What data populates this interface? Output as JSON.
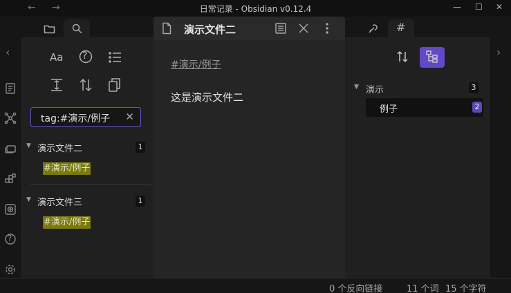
{
  "window": {
    "title": "日常记录 - Obsidian v0.12.4",
    "back_icon": "arrow-left-icon",
    "forward_icon": "arrow-right-icon",
    "minimize": "—",
    "maximize": "☐",
    "close": "✕"
  },
  "left_sidebar": {
    "tabs": [
      {
        "icon": "folder-icon",
        "active": false
      },
      {
        "icon": "search-icon",
        "active": true
      }
    ],
    "toolbar": {
      "match_case_label": "Aa",
      "help": "?",
      "items": [
        "match-case-icon",
        "help-icon",
        "explain-search-icon",
        "collapse-results-icon",
        "sort-icon",
        "copy-results-icon"
      ]
    },
    "search": {
      "value": "tag:#演示/例子",
      "clear": "✕"
    },
    "results": [
      {
        "title": "演示文件二",
        "count": "1",
        "match": "#演示/例子"
      },
      {
        "title": "演示文件三",
        "count": "1",
        "match": "#演示/例子"
      }
    ]
  },
  "ribbon": {
    "icons": [
      "open-quick-switcher-icon",
      "graph-view-icon",
      "slides-icon",
      "plugins-icon",
      "vault-icon",
      "help-icon",
      "settings-icon"
    ],
    "help_glyph": "?"
  },
  "editor": {
    "tab_title": "演示文件二",
    "tag_line": "#演示/例子",
    "body": "这是演示文件二"
  },
  "right_sidebar": {
    "tabs": [
      {
        "icon": "backlinks-icon",
        "active": false
      },
      {
        "icon": "tag-hash-icon",
        "active": true,
        "glyph": "#"
      }
    ],
    "tags": [
      {
        "label": "演示",
        "count": "3",
        "children": [
          {
            "label": "例子",
            "count": "2"
          }
        ]
      }
    ]
  },
  "statusbar": {
    "backlinks": "0 个反向链接",
    "words": "11 个词",
    "chars": "15 个字符"
  },
  "colors": {
    "accent": "#6249c7",
    "highlight": "#7a7a10",
    "background": "#202020"
  }
}
